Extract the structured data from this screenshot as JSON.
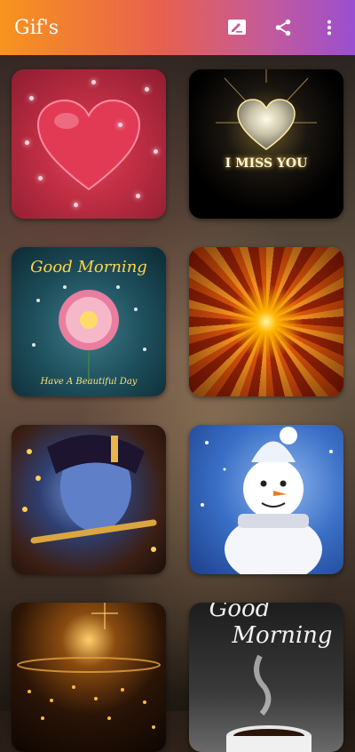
{
  "app": {
    "title": "Gif's"
  },
  "toolbar": {
    "icons": [
      "edit-icon",
      "share-icon",
      "more-vert-icon"
    ]
  },
  "tiles": [
    {
      "name": "heart-gif",
      "caption": ""
    },
    {
      "name": "i-miss-you-gif",
      "caption": "I MISS YOU"
    },
    {
      "name": "good-morning-flower-gif",
      "caption": "Good Morning",
      "subcaption": "Have A Beautiful Day"
    },
    {
      "name": "sunburst-gif",
      "caption": ""
    },
    {
      "name": "krishna-flute-gif",
      "caption": ""
    },
    {
      "name": "snowman-gif",
      "caption": ""
    },
    {
      "name": "golden-sparkle-gif",
      "caption": ""
    },
    {
      "name": "good-morning-coffee-gif",
      "caption": "Good",
      "subcaption": "Morning"
    }
  ],
  "colors": {
    "topbar_start": "#f7941d",
    "topbar_end": "#9b4fd0"
  }
}
